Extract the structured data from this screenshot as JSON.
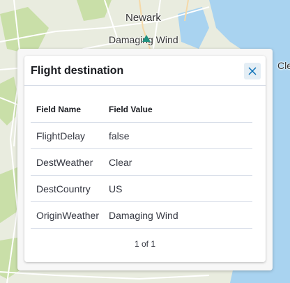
{
  "map": {
    "labels": {
      "city": "Newark",
      "weather_top": "Damaging Wind",
      "weather_edge": "Cle"
    },
    "colors": {
      "land": "#e9ecdf",
      "water": "#a9d3f0",
      "park": "#c9dfa8",
      "road": "#ffffff"
    }
  },
  "popup": {
    "title": "Flight destination",
    "close_icon": "close-icon",
    "table": {
      "headers": [
        "Field Name",
        "Field Value"
      ],
      "rows": [
        {
          "name": "FlightDelay",
          "value": "false"
        },
        {
          "name": "DestWeather",
          "value": "Clear"
        },
        {
          "name": "DestCountry",
          "value": "US"
        },
        {
          "name": "OriginWeather",
          "value": "Damaging Wind"
        }
      ]
    },
    "pagination": "1 of 1"
  }
}
